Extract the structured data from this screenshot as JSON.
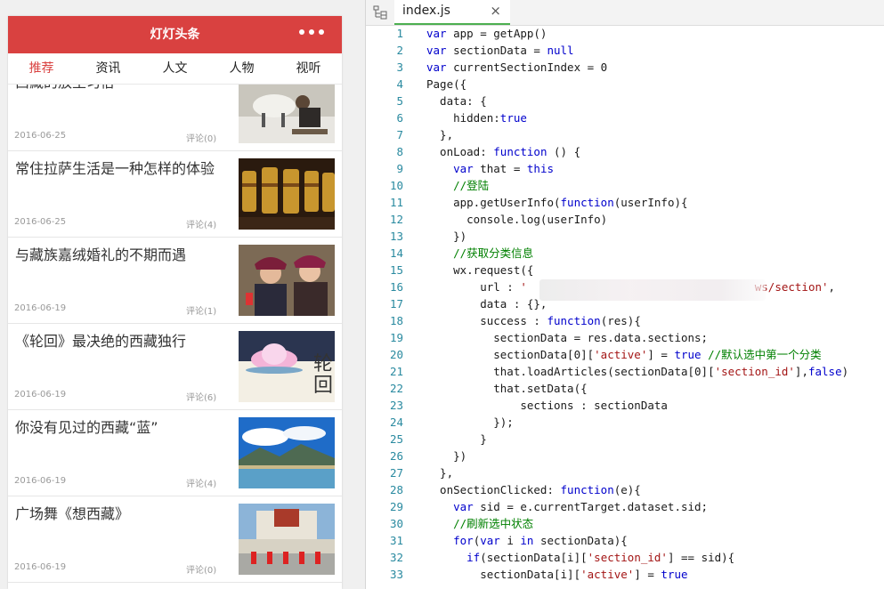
{
  "phone": {
    "nav_title": "灯灯头条",
    "more_icon": "more-dots-icon",
    "tabs": [
      "推荐",
      "资讯",
      "人文",
      "人物",
      "视听"
    ],
    "active_tab": 0,
    "articles": [
      {
        "title": "西藏的放生习俗",
        "date": "2016-06-25",
        "comment": "评论(0)",
        "thumb": "yak-release"
      },
      {
        "title": "常住拉萨生活是一种怎样的体验",
        "date": "2016-06-25",
        "comment": "评论(4)",
        "thumb": "prayer-wheels"
      },
      {
        "title": "与藏族嘉绒婚礼的不期而遇",
        "date": "2016-06-19",
        "comment": "评论(1)",
        "thumb": "tibetan-women"
      },
      {
        "title": "《轮回》最决绝的西藏独行",
        "date": "2016-06-19",
        "comment": "评论(6)",
        "thumb": "lotus-poster"
      },
      {
        "title": "你没有见过的西藏“蓝”",
        "date": "2016-06-19",
        "comment": "评论(4)",
        "thumb": "blue-sky-lake"
      },
      {
        "title": "广场舞《想西藏》",
        "date": "2016-06-19",
        "comment": "评论(0)",
        "thumb": "potala-dance"
      }
    ]
  },
  "editor": {
    "file_tab": "index.js",
    "close_glyph": "×",
    "lines": [
      "var app = getApp()",
      "var sectionData = null",
      "var currentSectionIndex = 0",
      "Page({",
      "  data: {",
      "    hidden:true",
      "  },",
      "  onLoad: function () {",
      "    var that = this",
      "    //登陆",
      "    app.getUserInfo(function(userInfo){",
      "      console.log(userInfo)",
      "    })",
      "    //获取分类信息",
      "    wx.request({",
      "        url : '                                  ws/section',",
      "        data : {},",
      "        success : function(res){",
      "          sectionData = res.data.sections;",
      "          sectionData[0]['active'] = true //默认选中第一个分类",
      "          that.loadArticles(sectionData[0]['section_id'],false)",
      "          that.setData({",
      "              sections : sectionData",
      "          });",
      "        }",
      "    })",
      "  },",
      "  onSectionClicked: function(e){",
      "    var sid = e.currentTarget.dataset.sid;",
      "    //刷新选中状态",
      "    for(var i in sectionData){",
      "      if(sectionData[i]['section_id'] == sid){",
      "        sectionData[i]['active'] = true"
    ]
  }
}
